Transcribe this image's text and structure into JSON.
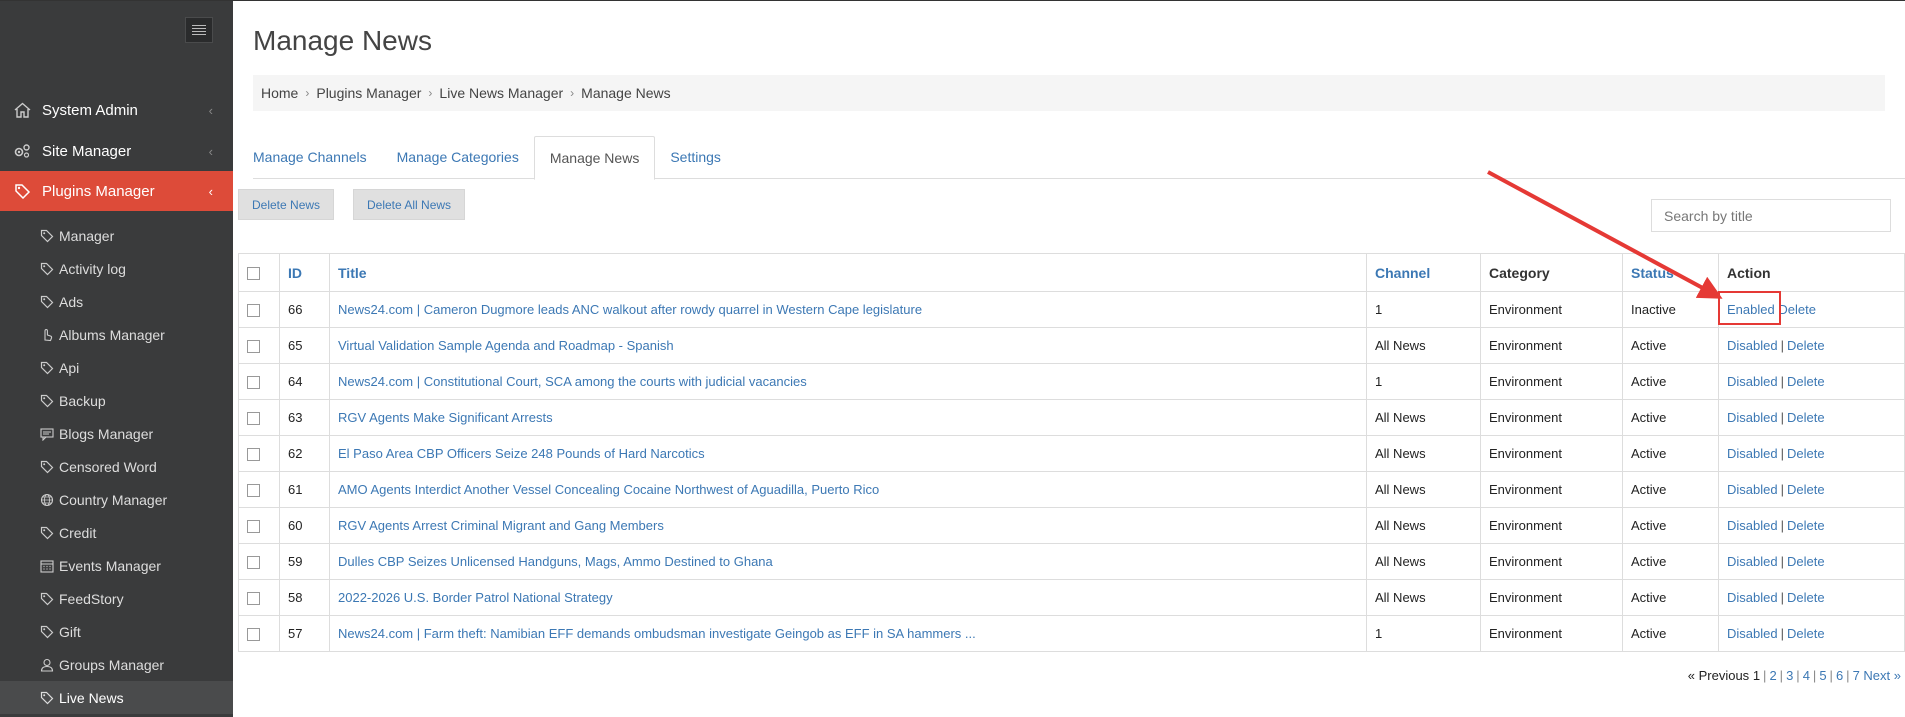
{
  "sidebar": {
    "top_items": [
      {
        "label": "System Admin",
        "icon": "home-icon"
      },
      {
        "label": "Site Manager",
        "icon": "gears-icon"
      },
      {
        "label": "Plugins Manager",
        "icon": "tag-icon"
      }
    ],
    "sub_items": [
      {
        "label": "Manager",
        "icon": "tag-icon"
      },
      {
        "label": "Activity log",
        "icon": "tag-icon"
      },
      {
        "label": "Ads",
        "icon": "tag-icon"
      },
      {
        "label": "Albums Manager",
        "icon": "hand-icon"
      },
      {
        "label": "Api",
        "icon": "tag-icon"
      },
      {
        "label": "Backup",
        "icon": "tag-icon"
      },
      {
        "label": "Blogs Manager",
        "icon": "comment-icon"
      },
      {
        "label": "Censored Word",
        "icon": "tag-icon"
      },
      {
        "label": "Country Manager",
        "icon": "globe-icon"
      },
      {
        "label": "Credit",
        "icon": "tag-icon"
      },
      {
        "label": "Events Manager",
        "icon": "calendar-icon"
      },
      {
        "label": "FeedStory",
        "icon": "tag-icon"
      },
      {
        "label": "Gift",
        "icon": "tag-icon"
      },
      {
        "label": "Groups Manager",
        "icon": "user-icon"
      },
      {
        "label": "Live News",
        "icon": "tag-icon"
      }
    ]
  },
  "page": {
    "title": "Manage News",
    "breadcrumb": [
      "Home",
      "Plugins Manager",
      "Live News Manager",
      "Manage News"
    ],
    "tabs": [
      "Manage Channels",
      "Manage Categories",
      "Manage News",
      "Settings"
    ],
    "active_tab": "Manage News",
    "buttons": {
      "delete_news": "Delete News",
      "delete_all_news": "Delete All News"
    },
    "search_placeholder": "Search by title"
  },
  "table": {
    "headers": {
      "id": "ID",
      "title": "Title",
      "channel": "Channel",
      "category": "Category",
      "status": "Status",
      "action": "Action"
    },
    "rows": [
      {
        "id": "66",
        "title": "News24.com | Cameron Dugmore leads ANC walkout after rowdy quarrel in Western Cape legislature",
        "channel": "1",
        "category": "Environment",
        "status": "Inactive",
        "toggle": "Enabled",
        "delete": "Delete"
      },
      {
        "id": "65",
        "title": "Virtual Validation Sample Agenda and Roadmap - Spanish",
        "channel": "All News",
        "category": "Environment",
        "status": "Active",
        "toggle": "Disabled",
        "delete": "Delete"
      },
      {
        "id": "64",
        "title": "News24.com | Constitutional Court, SCA among the courts with judicial vacancies",
        "channel": "1",
        "category": "Environment",
        "status": "Active",
        "toggle": "Disabled",
        "delete": "Delete"
      },
      {
        "id": "63",
        "title": "RGV Agents Make Significant Arrests",
        "channel": "All News",
        "category": "Environment",
        "status": "Active",
        "toggle": "Disabled",
        "delete": "Delete"
      },
      {
        "id": "62",
        "title": "El Paso Area CBP Officers Seize 248 Pounds of Hard Narcotics",
        "channel": "All News",
        "category": "Environment",
        "status": "Active",
        "toggle": "Disabled",
        "delete": "Delete"
      },
      {
        "id": "61",
        "title": "AMO Agents Interdict Another Vessel Concealing Cocaine Northwest of Aguadilla, Puerto Rico",
        "channel": "All News",
        "category": "Environment",
        "status": "Active",
        "toggle": "Disabled",
        "delete": "Delete"
      },
      {
        "id": "60",
        "title": "RGV Agents Arrest Criminal Migrant and Gang Members",
        "channel": "All News",
        "category": "Environment",
        "status": "Active",
        "toggle": "Disabled",
        "delete": "Delete"
      },
      {
        "id": "59",
        "title": "Dulles CBP Seizes Unlicensed Handguns, Mags, Ammo Destined to Ghana",
        "channel": "All News",
        "category": "Environment",
        "status": "Active",
        "toggle": "Disabled",
        "delete": "Delete"
      },
      {
        "id": "58",
        "title": "2022-2026 U.S. Border Patrol National Strategy",
        "channel": "All News",
        "category": "Environment",
        "status": "Active",
        "toggle": "Disabled",
        "delete": "Delete"
      },
      {
        "id": "57",
        "title": "News24.com | Farm theft: Namibian EFF demands ombudsman investigate Geingob as EFF in SA hammers ...",
        "channel": "1",
        "category": "Environment",
        "status": "Active",
        "toggle": "Disabled",
        "delete": "Delete"
      }
    ]
  },
  "pagination": {
    "previous": "« Previous",
    "current": "1",
    "pages": [
      "2",
      "3",
      "4",
      "5",
      "6",
      "7"
    ],
    "next": "Next »"
  },
  "colors": {
    "sidebar_bg": "#3a3b3c",
    "active_red": "#dd4b39",
    "link_blue": "#3c78b4",
    "annotation_red": "#e53935"
  }
}
